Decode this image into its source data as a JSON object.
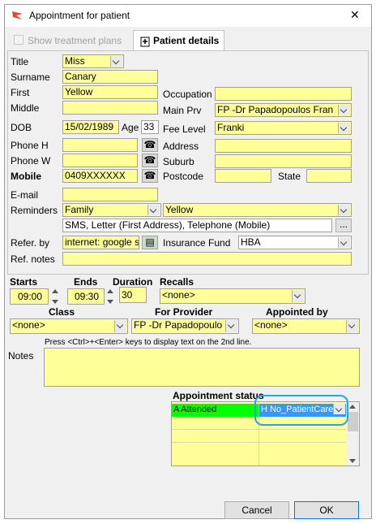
{
  "window": {
    "title": "Appointment for patient",
    "close_label": "✕"
  },
  "tabs": {
    "treatment": "Show treatment plans",
    "details": "Patient details"
  },
  "labels": {
    "title": "Title",
    "surname": "Surname",
    "first": "First",
    "middle": "Middle",
    "dob": "DOB",
    "age": "Age",
    "phone_h": "Phone H",
    "phone_w": "Phone W",
    "mobile": "Mobile",
    "email": "E-mail",
    "reminders": "Reminders",
    "refer_by": "Refer. by",
    "ref_notes": "Ref. notes",
    "occupation": "Occupation",
    "main_prv": "Main Prv",
    "fee_level": "Fee Level",
    "address": "Address",
    "suburb": "Suburb",
    "postcode": "Postcode",
    "state": "State",
    "insurance_fund": "Insurance Fund"
  },
  "patient": {
    "title": "Miss",
    "surname": "Canary",
    "first": "Yellow",
    "middle": "",
    "dob": "15/02/1989",
    "age": "33",
    "phone_h": "",
    "phone_w": "",
    "mobile": "0409XXXXXX",
    "email": "",
    "reminders_group": "Family",
    "reminders_who": "Yellow",
    "reminders_methods": "SMS, Letter (First Address), Telephone (Mobile)",
    "refer_by": "internet: google s",
    "ref_notes": "",
    "occupation": "",
    "main_prv": "FP -Dr Papadopoulos Fran",
    "fee_level": "Franki",
    "address": "",
    "suburb": "",
    "postcode": "",
    "state": "",
    "insurance_fund": "HBA"
  },
  "ellipsis": "...",
  "appointment": {
    "starts_label": "Starts",
    "ends_label": "Ends",
    "duration_label": "Duration",
    "recalls_label": "Recalls",
    "starts": "09:00",
    "ends": "09:30",
    "duration": "30",
    "recalls": "<none>",
    "class_label": "Class",
    "provider_label": "For Provider",
    "appointed_by_label": "Appointed by",
    "class": "<none>",
    "provider": "FP -Dr Papadopoulo",
    "appointed_by": "<none>",
    "notes_label": "Notes",
    "notes_hint": "Press <Ctrl>+<Enter> keys to display text on the 2nd line.",
    "notes": ""
  },
  "status": {
    "label": "Appointment status",
    "rows": [
      {
        "left": "A Attended",
        "right": "H No_PatientCare"
      }
    ]
  },
  "buttons": {
    "cancel": "Cancel",
    "ok": "OK"
  },
  "colors": {
    "field": "#ffff99",
    "attended": "#00ff00",
    "selected": "#3399ff",
    "highlight_ring": "#29a3e8"
  }
}
